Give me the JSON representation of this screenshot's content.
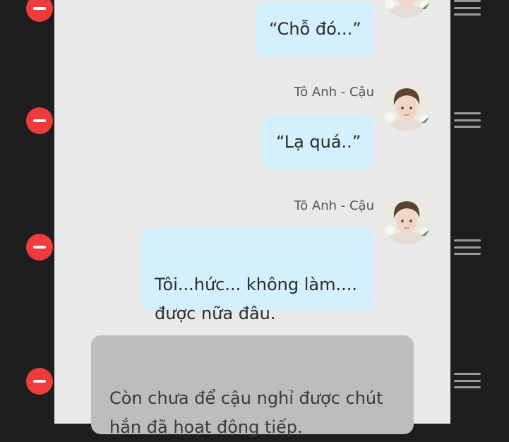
{
  "messages": [
    {
      "speaker": "",
      "text": "“Chỗ đó...”"
    },
    {
      "speaker": "Tô Anh - Cậu",
      "text": "“Lạ quá..”"
    },
    {
      "speaker": "Tô Anh - Cậu",
      "text": "Tôi...hức... không làm....\nđược nữa đâu."
    }
  ],
  "narration": {
    "text": "Còn chưa để cậu nghỉ được chút\nhắn đã hoạt động tiếp."
  },
  "colors": {
    "background": "#1e1e1e",
    "panel": "#e9e9e9",
    "bubble": "#d3f0fc",
    "narration": "#bdbdbd",
    "delete": "#ee3b3b",
    "handle": "#9a9a9a"
  },
  "icons": {
    "delete": "minus-circle-icon",
    "reorder": "drag-handle-icon",
    "avatar": "character-avatar"
  }
}
